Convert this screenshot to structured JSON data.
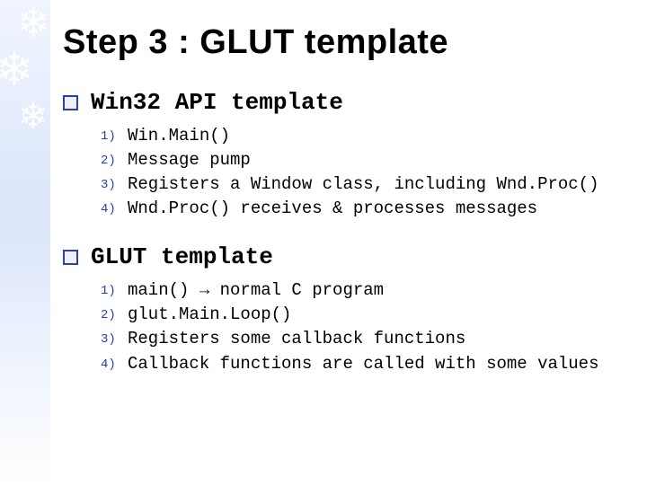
{
  "title": "Step 3 : GLUT template",
  "sections": [
    {
      "heading": "Win32 API template",
      "items": [
        {
          "n": "1)",
          "text": "Win.Main()"
        },
        {
          "n": "2)",
          "text": "Message pump"
        },
        {
          "n": "3)",
          "text": "Registers a Window class, including Wnd.Proc()"
        },
        {
          "n": "4)",
          "text": "Wnd.Proc() receives & processes messages"
        }
      ]
    },
    {
      "heading": "GLUT template",
      "items": [
        {
          "n": "1)",
          "text": "main()   →   normal C program"
        },
        {
          "n": "2)",
          "text": "glut.Main.Loop()"
        },
        {
          "n": "3)",
          "text": "Registers some callback functions"
        },
        {
          "n": "4)",
          "text": "Callback functions are called with some values"
        }
      ]
    }
  ]
}
